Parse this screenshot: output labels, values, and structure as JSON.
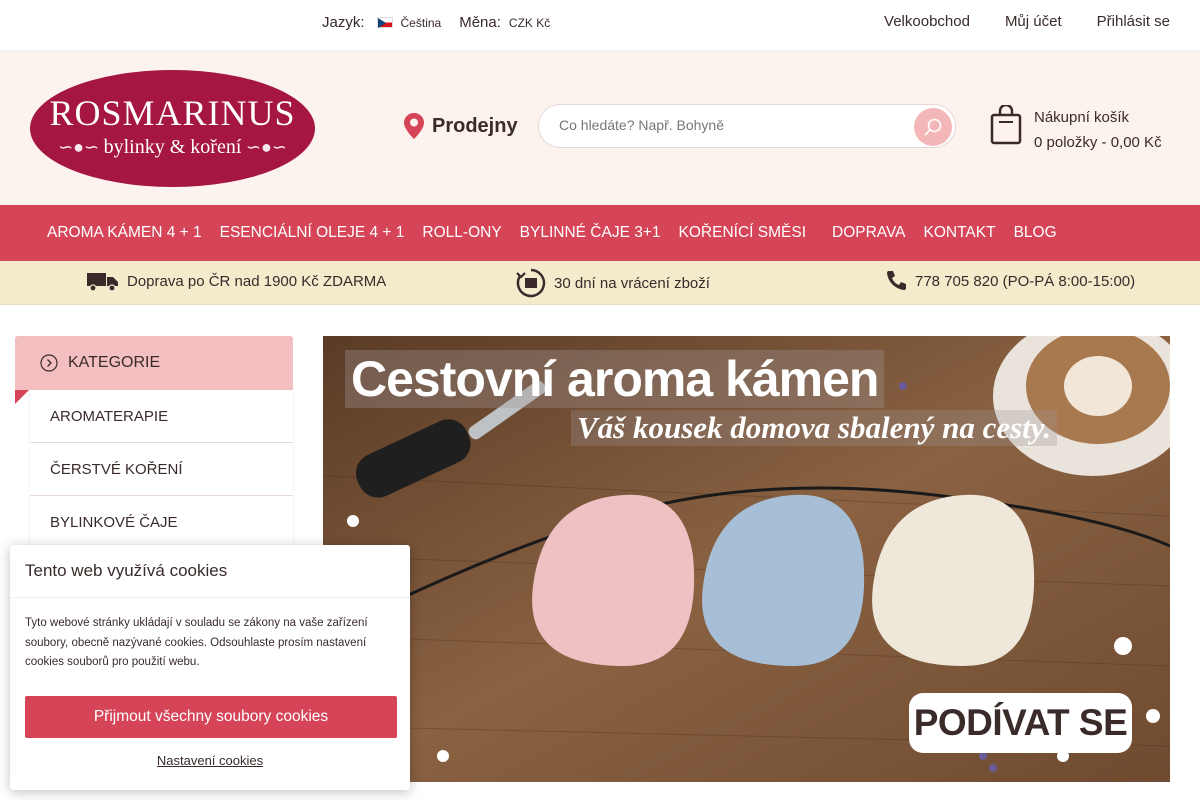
{
  "topbar": {
    "language_label": "Jazyk:",
    "language_value": "Čeština",
    "currency_label": "Měna:",
    "currency_value": "CZK Kč",
    "links": [
      "Velkoobchod",
      "Můj účet",
      "Přihlásit se"
    ]
  },
  "header": {
    "logo_line1": "ROSMARINUS",
    "logo_line2": "bylinky & koření",
    "stores_label": "Prodejny",
    "search_placeholder": "Co hledáte? Např. Bohyně",
    "cart_title": "Nákupní košík",
    "cart_summary": "0 položky - 0,00 Kč"
  },
  "nav": [
    "AROMA KÁMEN 4 + 1",
    "ESENCIÁLNÍ OLEJE 4 + 1",
    "ROLL-ONY",
    "BYLINNÉ ČAJE 3+1",
    "KOŘENÍCÍ SMĚSI",
    "DOPRAVA",
    "KONTAKT",
    "BLOG"
  ],
  "benefits": {
    "shipping": "Doprava po ČR nad 1900 Kč ZDARMA",
    "returns": "30 dní na vrácení zboží",
    "phone": "778 705 820 (PO-PÁ 8:00-15:00)"
  },
  "sidebar": {
    "heading": "KATEGORIE",
    "items": [
      "AROMATERAPIE",
      "ČERSTVÉ KOŘENÍ",
      "BYLINKOVÉ ČAJE"
    ]
  },
  "banner": {
    "title": "Cestovní aroma kámen",
    "subtitle": "Váš kousek domova sbalený na cesty.",
    "cta": "PODÍVAT SE"
  },
  "cookie": {
    "title": "Tento web využívá cookies",
    "body": "Tyto webové stránky ukládají v souladu se zákony na vaše zařízení soubory, obecně nazývané cookies. Odsouhlaste prosím nastavení cookies souborů pro použití webu.",
    "accept": "Přijmout všechny soubory cookies",
    "settings": "Nastavení cookies"
  },
  "colors": {
    "brand": "#a51642",
    "nav": "#d54457",
    "header_bg": "#fdf3ee",
    "benefits_bg": "#f4ebcc",
    "category_head": "#f4bfc0"
  }
}
